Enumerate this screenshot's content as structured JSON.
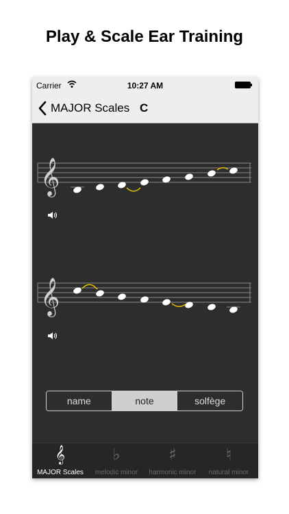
{
  "headline": "Play & Scale Ear Training",
  "status": {
    "carrier": "Carrier",
    "time": "10:27 AM"
  },
  "nav": {
    "title": "MAJOR Scales",
    "key": "C"
  },
  "staffs": {
    "clef": "𝄞",
    "ascending_notes": [
      "C",
      "D",
      "E",
      "F",
      "G",
      "A",
      "B",
      "C"
    ],
    "descending_notes": [
      "C",
      "B",
      "A",
      "G",
      "F",
      "E",
      "D",
      "C"
    ],
    "tie_color": "#e6c000",
    "note_color": "#ffffff",
    "line_color": "#8a8a8a"
  },
  "segmented": {
    "items": [
      "name",
      "note",
      "solfège"
    ],
    "selected": "note"
  },
  "tabs": [
    {
      "label": "MAJOR Scales",
      "glyph": "𝄞",
      "active": true
    },
    {
      "label": "melodic minor",
      "glyph": "♭",
      "active": false
    },
    {
      "label": "harmonic minor",
      "glyph": "♯",
      "active": false
    },
    {
      "label": "natural minor",
      "glyph": "♮",
      "active": false
    }
  ],
  "colors": {
    "background": "#2d2d2d",
    "bar": "#eeeeee",
    "tabbar": "#262626",
    "segment_active": "#cfcfcf"
  }
}
